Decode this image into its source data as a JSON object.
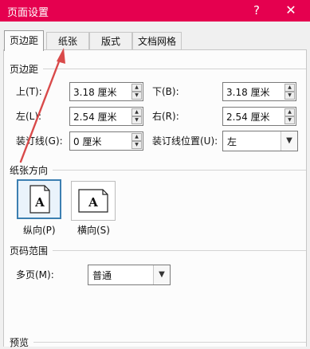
{
  "window": {
    "title": "页面设置",
    "help": "?",
    "close": "✕"
  },
  "tabs": [
    {
      "label": "页边距",
      "active": true
    },
    {
      "label": "纸张"
    },
    {
      "label": "版式"
    },
    {
      "label": "文档网格"
    }
  ],
  "margins": {
    "section": "页边距",
    "top": {
      "label": "上(T):",
      "value": "3.18 厘米"
    },
    "bottom": {
      "label": "下(B):",
      "value": "3.18 厘米"
    },
    "left": {
      "label": "左(L):",
      "value": "2.54 厘米"
    },
    "right": {
      "label": "右(R):",
      "value": "2.54 厘米"
    },
    "gutter": {
      "label": "装订线(G):",
      "value": "0 厘米"
    },
    "gutter_position": {
      "label": "装订线位置(U):",
      "value": "左"
    }
  },
  "orientation": {
    "section": "纸张方向",
    "glyph": "A",
    "portrait": "纵向(P)",
    "landscape": "横向(S)",
    "selected": "portrait"
  },
  "pages": {
    "section": "页码范围",
    "multiple_label": "多页(M):",
    "multiple_value": "普通"
  },
  "preview": {
    "section": "预览"
  },
  "colors": {
    "titlebar": "#e5004f",
    "annotation_arrow": "#d94a4a",
    "selection": "#3c7fb1"
  }
}
